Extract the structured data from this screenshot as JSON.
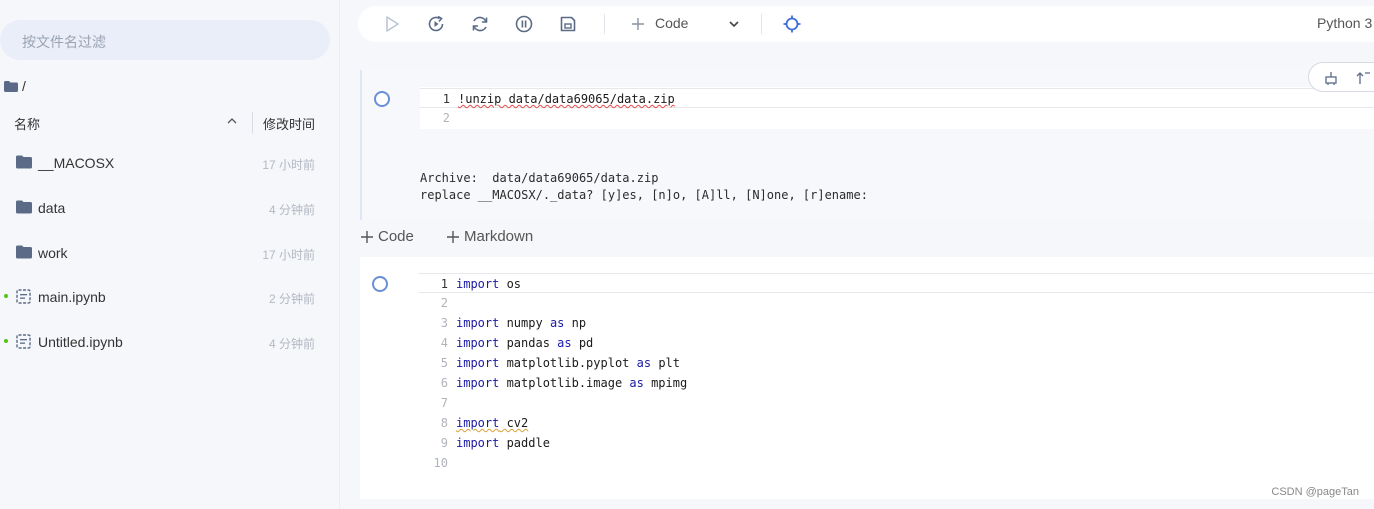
{
  "sidebar": {
    "search_placeholder": "按文件名过滤",
    "path": "/",
    "columns": {
      "name": "名称",
      "modified": "修改时间"
    },
    "files": [
      {
        "name": "__MACOSX",
        "time": "17 小时前",
        "type": "folder"
      },
      {
        "name": "data",
        "time": "4 分钟前",
        "type": "folder"
      },
      {
        "name": "work",
        "time": "17 小时前",
        "type": "folder"
      },
      {
        "name": "main.ipynb",
        "time": "2 分钟前",
        "type": "notebook"
      },
      {
        "name": "Untitled.ipynb",
        "time": "4 分钟前",
        "type": "notebook"
      }
    ]
  },
  "toolbar": {
    "cell_type": "Code",
    "kernel": "Python 3",
    "icons": [
      "play-icon",
      "run-all-icon",
      "restart-icon",
      "stop-icon",
      "save-icon",
      "plus-icon",
      "chevron-down-icon",
      "locate-icon"
    ]
  },
  "cell1": {
    "lines": [
      {
        "no": "1",
        "text": "!unzip data/data69065/data.zip"
      },
      {
        "no": "2",
        "text": ""
      }
    ],
    "output": "Archive:  data/data69065/data.zip\nreplace __MACOSX/._data? [y]es, [n]o, [A]ll, [N]one, [r]ename:"
  },
  "add_bar": {
    "code": "Code",
    "markdown": "Markdown"
  },
  "cell2": {
    "lines": [
      {
        "no": "1",
        "text": "import os"
      },
      {
        "no": "2",
        "text": ""
      },
      {
        "no": "3",
        "text": "import numpy as np"
      },
      {
        "no": "4",
        "text": "import pandas as pd"
      },
      {
        "no": "5",
        "text": "import matplotlib.pyplot as plt"
      },
      {
        "no": "6",
        "text": "import matplotlib.image as mpimg"
      },
      {
        "no": "7",
        "text": ""
      },
      {
        "no": "8",
        "text": "import cv2"
      },
      {
        "no": "9",
        "text": "import paddle"
      },
      {
        "no": "10",
        "text": ""
      }
    ]
  },
  "watermark": "CSDN @pageTan",
  "colors": {
    "accent": "#3c6fd6",
    "kernel_dot_green": "#52c41a",
    "keyword": "#1a1aa6"
  }
}
